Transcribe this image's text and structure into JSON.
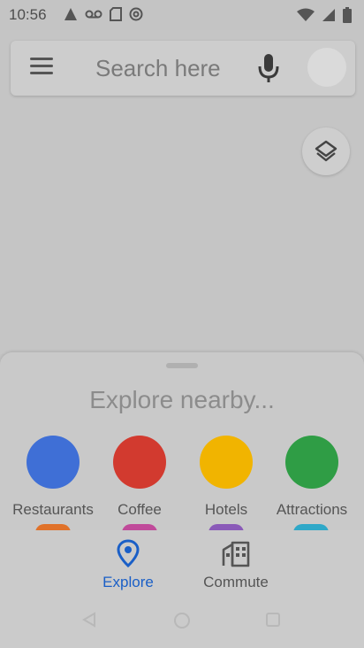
{
  "status_bar": {
    "time": "10:56",
    "left_icons": [
      "alert-icon",
      "voicemail-icon",
      "sd-card-icon",
      "at-icon"
    ],
    "right_icons": [
      "wifi-icon",
      "signal-icon",
      "battery-icon"
    ]
  },
  "search": {
    "placeholder": "Search here",
    "menu_icon": "hamburger-menu-icon",
    "mic_icon": "microphone-icon"
  },
  "map": {
    "layers_icon": "layers-icon"
  },
  "sheet": {
    "title": "Explore nearby...",
    "categories": [
      {
        "label": "Restaurants",
        "color": "#3f6fd6"
      },
      {
        "label": "Coffee",
        "color": "#d23a2f"
      },
      {
        "label": "Hotels",
        "color": "#f1b400"
      },
      {
        "label": "Attractions",
        "color": "#2f9d45"
      }
    ],
    "more_row_colors": [
      "#e0722a",
      "#c04a9a",
      "#8a5ab8",
      "#2fa8c8"
    ]
  },
  "bottom_nav": {
    "tabs": [
      {
        "label": "Explore",
        "icon": "location-pin-icon",
        "selected": true
      },
      {
        "label": "Commute",
        "icon": "commute-buildings-icon",
        "selected": false
      }
    ]
  },
  "colors": {
    "accent": "#1a5fc7"
  }
}
